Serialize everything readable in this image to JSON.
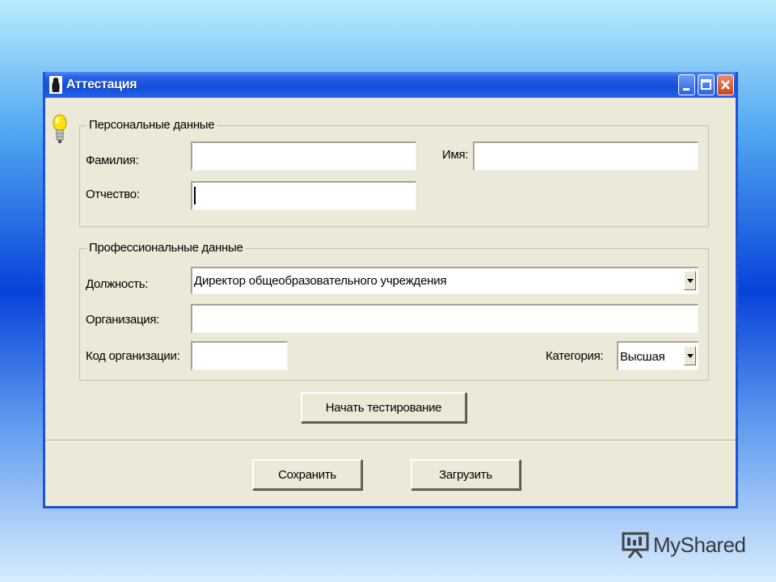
{
  "window": {
    "title": "Аттестация",
    "title_color": "#ffffff",
    "frame_color": "#1f53d6"
  },
  "personal": {
    "legend": "Персональные данные",
    "surname_label": "Фамилия:",
    "surname_value": "",
    "name_label": "Имя:",
    "name_value": "",
    "patronymic_label": "Отчество:",
    "patronymic_value": ""
  },
  "professional": {
    "legend": "Профессиональные данные",
    "position_label": "Должность:",
    "position_value": "Директор общеобразовательного учреждения",
    "organization_label": "Организация:",
    "organization_value": "",
    "org_code_label": "Код организации:",
    "org_code_value": "",
    "category_label": "Категория:",
    "category_value": "Высшая"
  },
  "actions": {
    "start_test": "Начать тестирование",
    "save": "Сохранить",
    "load": "Загрузить"
  },
  "icons": {
    "app": "person-silhouette-icon",
    "hint": "lightbulb-icon"
  },
  "watermark": {
    "brand": "MyShared"
  }
}
